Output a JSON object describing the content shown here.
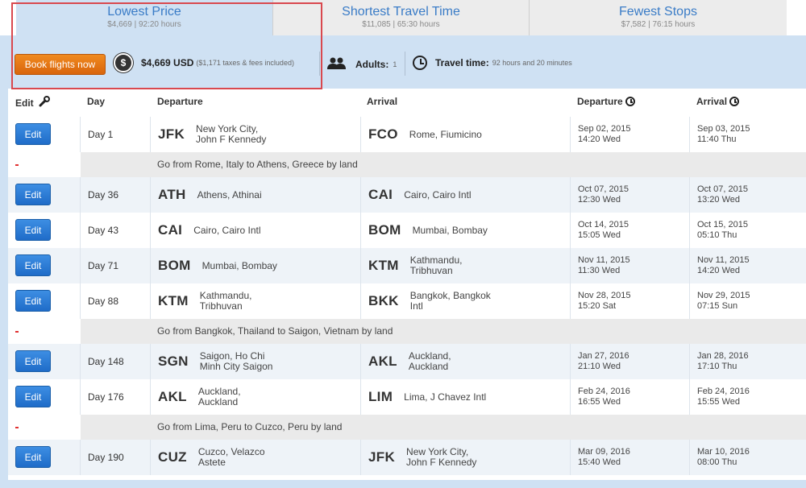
{
  "tabs": [
    {
      "title": "Lowest Price",
      "sub": "$4,669 | 92:20 hours"
    },
    {
      "title": "Shortest Travel Time",
      "sub": "$11,085 | 65:30 hours"
    },
    {
      "title": "Fewest Stops",
      "sub": "$7,582 | 76:15 hours"
    }
  ],
  "summary": {
    "book_label": "Book flights now",
    "price": "$4,669 USD",
    "taxes": "($1,171 taxes & fees included)",
    "adults_label": "Adults:",
    "adults_value": "1",
    "travel_label": "Travel time:",
    "travel_value": "92 hours and 20 minutes",
    "icons": {
      "price": "dollar-coin-icon",
      "adults": "people-icon",
      "travel": "clock-icon"
    }
  },
  "table": {
    "headers": {
      "edit": "Edit",
      "day": "Day",
      "departure": "Departure",
      "arrival": "Arrival",
      "dep_time": "Departure",
      "arr_time": "Arrival"
    },
    "edit_label": "Edit",
    "flights": [
      {
        "day": "Day 1",
        "from_code": "JFK",
        "from_city1": "New York City,",
        "from_city2": "John F Kennedy",
        "to_code": "FCO",
        "to_city1": "Rome, Fiumicino",
        "to_city2": "",
        "dep1": "Sep 02, 2015",
        "dep2": "14:20 Wed",
        "arr1": "Sep 03, 2015",
        "arr2": "11:40 Thu"
      },
      {
        "day": "Day 36",
        "from_code": "ATH",
        "from_city1": "Athens, Athinai",
        "from_city2": "",
        "to_code": "CAI",
        "to_city1": "Cairo, Cairo Intl",
        "to_city2": "",
        "dep1": "Oct 07, 2015",
        "dep2": "12:30 Wed",
        "arr1": "Oct 07, 2015",
        "arr2": "13:20 Wed"
      },
      {
        "day": "Day 43",
        "from_code": "CAI",
        "from_city1": "Cairo, Cairo Intl",
        "from_city2": "",
        "to_code": "BOM",
        "to_city1": "Mumbai, Bombay",
        "to_city2": "",
        "dep1": "Oct 14, 2015",
        "dep2": "15:05 Wed",
        "arr1": "Oct 15, 2015",
        "arr2": "05:10 Thu"
      },
      {
        "day": "Day 71",
        "from_code": "BOM",
        "from_city1": "Mumbai, Bombay",
        "from_city2": "",
        "to_code": "KTM",
        "to_city1": "Kathmandu,",
        "to_city2": "Tribhuvan",
        "dep1": "Nov 11, 2015",
        "dep2": "11:30 Wed",
        "arr1": "Nov 11, 2015",
        "arr2": "14:20 Wed"
      },
      {
        "day": "Day 88",
        "from_code": "KTM",
        "from_city1": "Kathmandu,",
        "from_city2": "Tribhuvan",
        "to_code": "BKK",
        "to_city1": "Bangkok, Bangkok",
        "to_city2": "Intl",
        "dep1": "Nov 28, 2015",
        "dep2": "15:20 Sat",
        "arr1": "Nov 29, 2015",
        "arr2": "07:15 Sun"
      },
      {
        "day": "Day 148",
        "from_code": "SGN",
        "from_city1": "Saigon, Ho Chi",
        "from_city2": "Minh City Saigon",
        "to_code": "AKL",
        "to_city1": "Auckland,",
        "to_city2": "Auckland",
        "dep1": "Jan 27, 2016",
        "dep2": "21:10 Wed",
        "arr1": "Jan 28, 2016",
        "arr2": "17:10 Thu"
      },
      {
        "day": "Day 176",
        "from_code": "AKL",
        "from_city1": "Auckland,",
        "from_city2": "Auckland",
        "to_code": "LIM",
        "to_city1": "Lima, J Chavez Intl",
        "to_city2": "",
        "dep1": "Feb 24, 2016",
        "dep2": "16:55 Wed",
        "arr1": "Feb 24, 2016",
        "arr2": "15:55 Wed"
      },
      {
        "day": "Day 190",
        "from_code": "CUZ",
        "from_city1": "Cuzco, Velazco",
        "from_city2": "Astete",
        "to_code": "JFK",
        "to_city1": "New York City,",
        "to_city2": "John F Kennedy",
        "dep1": "Mar 09, 2016",
        "dep2": "15:40 Wed",
        "arr1": "Mar 10, 2016",
        "arr2": "08:00 Thu"
      }
    ],
    "land": [
      {
        "text": "Go from Rome, Italy to Athens, Greece by land"
      },
      {
        "text": "Go from Bangkok, Thailand to Saigon, Vietnam by land"
      },
      {
        "text": "Go from Lima, Peru to Cuzco, Peru by land"
      }
    ]
  }
}
